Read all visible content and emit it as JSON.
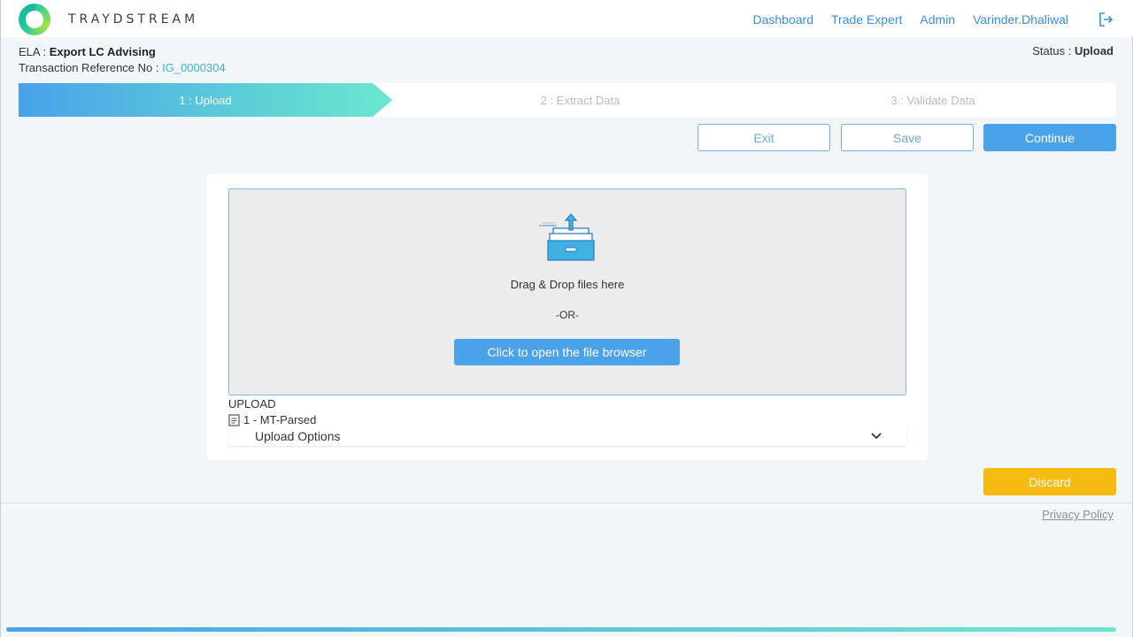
{
  "brand": {
    "name": "TRAYDSTREAM"
  },
  "nav": {
    "items": [
      {
        "label": "Dashboard"
      },
      {
        "label": "Trade Expert"
      },
      {
        "label": "Admin"
      },
      {
        "label": "Varinder.Dhaliwal"
      }
    ],
    "logout_icon": "logout-icon"
  },
  "transaction": {
    "type_label": "ELA :",
    "type_value": "Export LC Advising",
    "ref_label": "Transaction Reference No :",
    "ref_value": "IG_0000304"
  },
  "status": {
    "label": "Status :",
    "value": "Upload"
  },
  "steps": [
    {
      "label": "1 : Upload",
      "active": true
    },
    {
      "label": "2 : Extract Data",
      "active": false
    },
    {
      "label": "3 : Validate Data",
      "active": false
    }
  ],
  "actions": {
    "exit": "Exit",
    "save": "Save",
    "continue": "Continue",
    "discard": "Discard"
  },
  "upload": {
    "dropzone_text": "Drag & Drop files here",
    "or_text": "-OR-",
    "browse_button": "Click to open the file browser",
    "section_title": "UPLOAD",
    "files": [
      {
        "label": "1 - MT-Parsed"
      }
    ],
    "options_label": "Upload Options"
  },
  "footer": {
    "privacy": "Privacy Policy"
  },
  "colors": {
    "accent": "#4aa2ea",
    "gradient_end": "#6ae7cf",
    "discard": "#f6bb10",
    "link": "#3a8fd6"
  }
}
